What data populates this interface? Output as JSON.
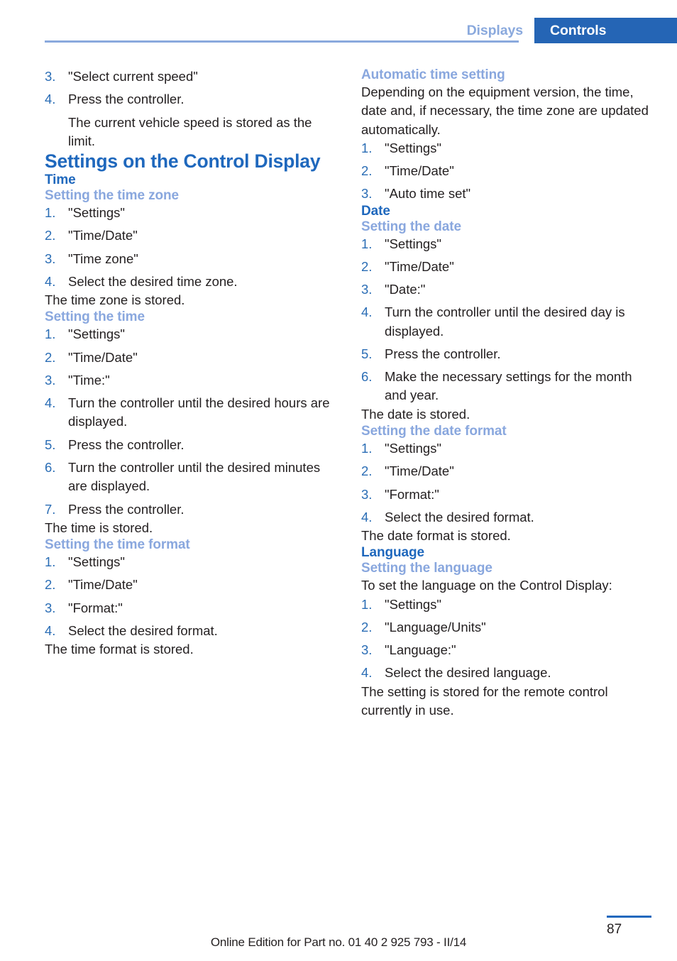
{
  "header": {
    "tab_inactive": "Displays",
    "tab_active": "Controls"
  },
  "colors": {
    "accent_dark_blue": "#1f68bd",
    "accent_light_blue": "#89a7de",
    "tab_active_bg": "#2565b5",
    "list_number": "#2a6db5",
    "body_text": "#231f20"
  },
  "left_column": {
    "continued_steps": [
      "\"Select current speed\"",
      "Press the controller."
    ],
    "continued_note": "The current vehicle speed is stored as the limit.",
    "title": "Settings on the Control Display",
    "section_time": "Time",
    "time_zone": {
      "heading": "Setting the time zone",
      "steps": [
        "\"Settings\"",
        "\"Time/Date\"",
        "\"Time zone\"",
        "Select the desired time zone."
      ],
      "result": "The time zone is stored."
    },
    "time": {
      "heading": "Setting the time",
      "steps": [
        "\"Settings\"",
        "\"Time/Date\"",
        "\"Time:\"",
        "Turn the controller until the desired hours are displayed.",
        "Press the controller.",
        "Turn the controller until the desired minutes are displayed.",
        "Press the controller."
      ],
      "result": "The time is stored."
    },
    "time_format": {
      "heading": "Setting the time format",
      "steps": [
        "\"Settings\"",
        "\"Time/Date\"",
        "\"Format:\"",
        "Select the desired format."
      ],
      "result": "The time format is stored."
    }
  },
  "right_column": {
    "auto_time": {
      "heading": "Automatic time setting",
      "intro": "Depending on the equipment version, the time, date and, if necessary, the time zone are updated automatically.",
      "steps": [
        "\"Settings\"",
        "\"Time/Date\"",
        "\"Auto time set\""
      ]
    },
    "section_date": "Date",
    "date": {
      "heading": "Setting the date",
      "steps": [
        "\"Settings\"",
        "\"Time/Date\"",
        "\"Date:\"",
        "Turn the controller until the desired day is displayed.",
        "Press the controller.",
        "Make the necessary settings for the month and year."
      ],
      "result": "The date is stored."
    },
    "date_format": {
      "heading": "Setting the date format",
      "steps": [
        "\"Settings\"",
        "\"Time/Date\"",
        "\"Format:\"",
        "Select the desired format."
      ],
      "result": "The date format is stored."
    },
    "section_language": "Language",
    "language": {
      "heading": "Setting the language",
      "intro": "To set the language on the Control Display:",
      "steps": [
        "\"Settings\"",
        "\"Language/Units\"",
        "\"Language:\"",
        "Select the desired language."
      ],
      "result": "The setting is stored for the remote control currently in use."
    }
  },
  "footer": {
    "edition": "Online Edition for Part no. 01 40 2 925 793 - II/14",
    "page_number": "87"
  }
}
